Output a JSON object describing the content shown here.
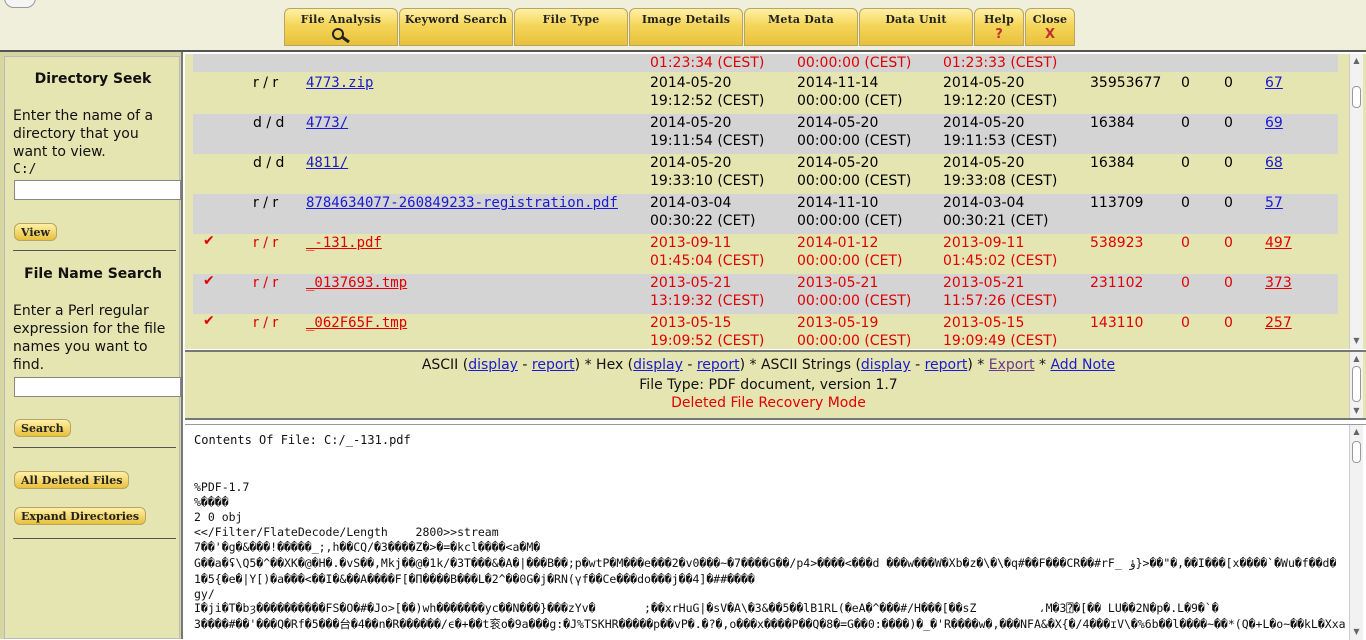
{
  "toolbar": {
    "tabs": [
      {
        "label": "File Analysis",
        "icon": "magnifier-icon"
      },
      {
        "label": "Keyword Search"
      },
      {
        "label": "File Type"
      },
      {
        "label": "Image Details"
      },
      {
        "label": "Meta Data"
      },
      {
        "label": "Data Unit"
      },
      {
        "label": "Help",
        "sub": "?"
      },
      {
        "label": "Close",
        "sub": "X"
      }
    ]
  },
  "sidebar": {
    "dir_title": "Directory Seek",
    "dir_help": "Enter the name of a directory that you want to view.",
    "dir_prefix": "C:/",
    "dir_input_value": "",
    "view_button": "View",
    "name_title": "File Name Search",
    "name_help": "Enter a Perl regular expression for the file names you want to find.",
    "name_input_value": "",
    "search_button": "Search",
    "all_deleted_button": "All Deleted Files",
    "expand_button": "Expand Directories"
  },
  "file_list": {
    "partial_row": {
      "written": "01:23:34 (CEST)",
      "accessed": "00:00:00 (CEST)",
      "created": "01:23:33 (CEST)"
    },
    "rows": [
      {
        "deleted": false,
        "type": "r / r",
        "name": "4773.zip",
        "written_date": "2014-05-20",
        "written_time": "19:12:52 (CEST)",
        "accessed_date": "2014-11-14",
        "accessed_time": "00:00:00 (CET)",
        "created_date": "2014-05-20",
        "created_time": "19:12:20 (CEST)",
        "size": "35953677",
        "uid": "0",
        "gid": "0",
        "meta": "67"
      },
      {
        "deleted": false,
        "type": "d / d",
        "name": "4773/",
        "written_date": "2014-05-20",
        "written_time": "19:11:54 (CEST)",
        "accessed_date": "2014-05-20",
        "accessed_time": "00:00:00 (CEST)",
        "created_date": "2014-05-20",
        "created_time": "19:11:53 (CEST)",
        "size": "16384",
        "uid": "0",
        "gid": "0",
        "meta": "69"
      },
      {
        "deleted": false,
        "type": "d / d",
        "name": "4811/",
        "written_date": "2014-05-20",
        "written_time": "19:33:10 (CEST)",
        "accessed_date": "2014-05-20",
        "accessed_time": "00:00:00 (CEST)",
        "created_date": "2014-05-20",
        "created_time": "19:33:08 (CEST)",
        "size": "16384",
        "uid": "0",
        "gid": "0",
        "meta": "68"
      },
      {
        "deleted": false,
        "type": "r / r",
        "name": "8784634077-260849233-registration.pdf",
        "written_date": "2014-03-04",
        "written_time": "00:30:22 (CET)",
        "accessed_date": "2014-11-10",
        "accessed_time": "00:00:00 (CET)",
        "created_date": "2014-03-04",
        "created_time": "00:30:21 (CET)",
        "size": "113709",
        "uid": "0",
        "gid": "0",
        "meta": "57"
      },
      {
        "deleted": true,
        "type": "r / r",
        "name": "_-131.pdf",
        "written_date": "2013-09-11",
        "written_time": "01:45:04 (CEST)",
        "accessed_date": "2014-01-12",
        "accessed_time": "00:00:00 (CET)",
        "created_date": "2013-09-11",
        "created_time": "01:45:02 (CEST)",
        "size": "538923",
        "uid": "0",
        "gid": "0",
        "meta": "497"
      },
      {
        "deleted": true,
        "type": "r / r",
        "name": "_0137693.tmp",
        "written_date": "2013-05-21",
        "written_time": "13:19:32 (CEST)",
        "accessed_date": "2013-05-21",
        "accessed_time": "00:00:00 (CEST)",
        "created_date": "2013-05-21",
        "created_time": "11:57:26 (CEST)",
        "size": "231102",
        "uid": "0",
        "gid": "0",
        "meta": "373"
      },
      {
        "deleted": true,
        "type": "r / r",
        "name": "_062F65F.tmp",
        "written_date": "2013-05-15",
        "written_time": "19:09:52 (CEST)",
        "accessed_date": "2013-05-19",
        "accessed_time": "00:00:00 (CEST)",
        "created_date": "2013-05-15",
        "created_time": "19:09:49 (CEST)",
        "size": "143110",
        "uid": "0",
        "gid": "0",
        "meta": "257"
      }
    ]
  },
  "info": {
    "ascii": "ASCII",
    "hex": "Hex",
    "ascii_strings": "ASCII Strings",
    "display": "display",
    "report": "report",
    "export": "Export",
    "add_note": "Add Note",
    "file_type": "File Type: PDF document, version 1.7",
    "mode": "Deleted File Recovery Mode"
  },
  "contents": {
    "header": "Contents Of File: C:/_-131.pdf",
    "lines": [
      "%PDF-1.7",
      "%����",
      "2 0 obj",
      "<</Filter/FlateDecode/Length    2800>>stream",
      "7��'�g�&���!�����_;,h��CQ/�3����Z�>�=�kcl����<a�M�",
      "G��a�ʢ\\Q5�^��XK�@�H�.�vS��,Mkj��@�1k/�3T���&�A�|���B��;p�wtP�M���e���2�v0���~�7����G��/p4>����<���d ���w���W�Xb�z�\\�\\�q#��F���CR��#rF_ ؤ}>��\"�,��I���[x����`�Wu�f��d�",
      "1�5{�e�|Y[)�a���<��I�&��A����F[�П����B���L�2^��0G�j�RN(γf��Ce���do���j��4]�##����",
      "gy/",
      "I�ji�T�bȝ����������FS�O�#�Jo>[��)wh�������yc��N���}���zYv�       ;��xrHuG|�sV�A\\�3&��5��lB1RL(�eA�^���#/H���[��sZ         ،M�3⍰�[�� LU��2N�p�.L�9�`�",
      "3����#��'���Q�Rf�5���台�4��n�R������/ϵ�+��t衮ο�9a���g:�J%TSKHR�����p��vP�.�?�,o���x����P��Q�8�=G��0:����)�_�'R����w�,���NFA&�X{�/4���ɪV\\�%6b��l����~��*(Q�+L�o~��kL�Xxa"
    ]
  }
}
